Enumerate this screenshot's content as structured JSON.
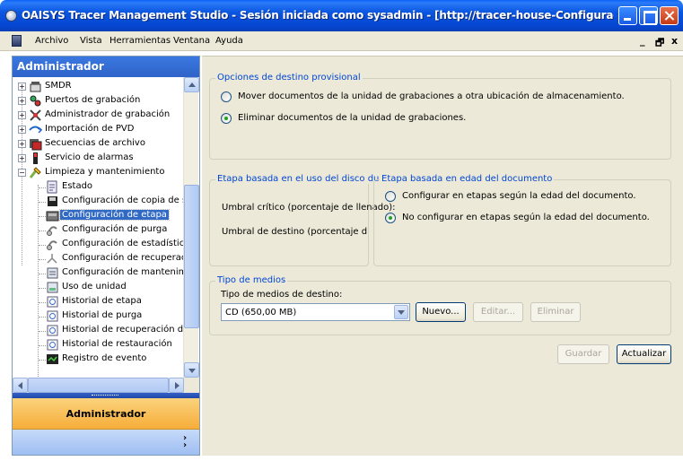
{
  "window": {
    "title": "OAISYS Tracer Management Studio - Sesión iniciada como sysadmin - [http://tracer-house-Configuración de etapa  - Administr...",
    "minimize_icon": "minimize-icon",
    "maximize_icon": "maximize-icon",
    "close_icon": "close-icon"
  },
  "menubar": {
    "items": [
      "Archivo",
      "Vista",
      "Herramientas",
      "Ventana",
      "Ayuda"
    ],
    "mdi_min": "_",
    "mdi_restore": "🗗",
    "mdi_close": "x"
  },
  "sidebar": {
    "header": "Administrador",
    "tree": [
      {
        "label": "SMDR",
        "expander": "+",
        "icon": "phone-icon",
        "level": 0
      },
      {
        "label": "Puertos de grabación",
        "expander": "+",
        "icon": "ports-icon",
        "level": 0
      },
      {
        "label": "Administrador de grabación",
        "expander": "+",
        "icon": "recording-manager-icon",
        "level": 0
      },
      {
        "label": "Importación de PVD",
        "expander": "+",
        "icon": "import-icon",
        "level": 0
      },
      {
        "label": "Secuencias de archivo",
        "expander": "+",
        "icon": "archive-sequence-icon",
        "level": 0
      },
      {
        "label": "Servicio de alarmas",
        "expander": "+",
        "icon": "alarm-icon",
        "level": 0
      },
      {
        "label": "Limpieza y mantenimiento",
        "expander": "−",
        "icon": "cleanup-icon",
        "level": 0
      },
      {
        "label": "Estado",
        "icon": "status-icon",
        "level": 1
      },
      {
        "label": "Configuración de copia de seguric",
        "icon": "backup-icon",
        "level": 1
      },
      {
        "label": "Configuración de etapa",
        "icon": "stage-icon",
        "level": 1,
        "selected": true
      },
      {
        "label": "Configuración de purga",
        "icon": "purge-icon",
        "level": 1
      },
      {
        "label": "Configuración de estadísticas del",
        "icon": "statistics-icon",
        "level": 1
      },
      {
        "label": "Configuración de recuperación de",
        "icon": "recovery-icon",
        "level": 1
      },
      {
        "label": "Configuración de mantenimiento d",
        "icon": "maintenance-icon",
        "level": 1
      },
      {
        "label": "Uso de unidad",
        "icon": "drive-usage-icon",
        "level": 1
      },
      {
        "label": "Historial de etapa",
        "icon": "history-icon",
        "level": 1
      },
      {
        "label": "Historial de purga",
        "icon": "history-icon",
        "level": 1
      },
      {
        "label": "Historial de recuperación de archi",
        "icon": "history-icon",
        "level": 1
      },
      {
        "label": "Historial de restauración",
        "icon": "history-icon",
        "level": 1
      },
      {
        "label": "Registro de evento",
        "icon": "event-log-icon",
        "level": 1
      }
    ],
    "nav_button": "Administrador",
    "nav_more_icon": "chevron-double-down-icon"
  },
  "main": {
    "provisional": {
      "title": "Opciones de destino provisional",
      "options": [
        {
          "label": "Mover documentos de la unidad de grabaciones a otra ubicación de almacenamiento.",
          "selected": false
        },
        {
          "label": "Eliminar documentos de la unidad de grabaciones.",
          "selected": true
        }
      ]
    },
    "disk_usage": {
      "title": "Etapa basada en el uso del disco duro",
      "critical_label": "Umbral crítico (porcentaje de llenado):",
      "target_label": "Umbral de destino (porcentaje de llenado"
    },
    "doc_age": {
      "title": "Etapa basada en edad del documento",
      "options": [
        {
          "label": "Configurar en etapas según la edad del documento.",
          "selected": false
        },
        {
          "label": "No configurar en etapas según la edad del documento.",
          "selected": true
        }
      ]
    },
    "media": {
      "title": "Tipo de medios",
      "field_label": "Tipo de medios de destino:",
      "selected_value": "CD (650,00 MB)",
      "new_button": "Nuevo...",
      "edit_button": "Editar...",
      "delete_button": "Eliminar"
    },
    "save_button": "Guardar",
    "refresh_button": "Actualizar"
  }
}
